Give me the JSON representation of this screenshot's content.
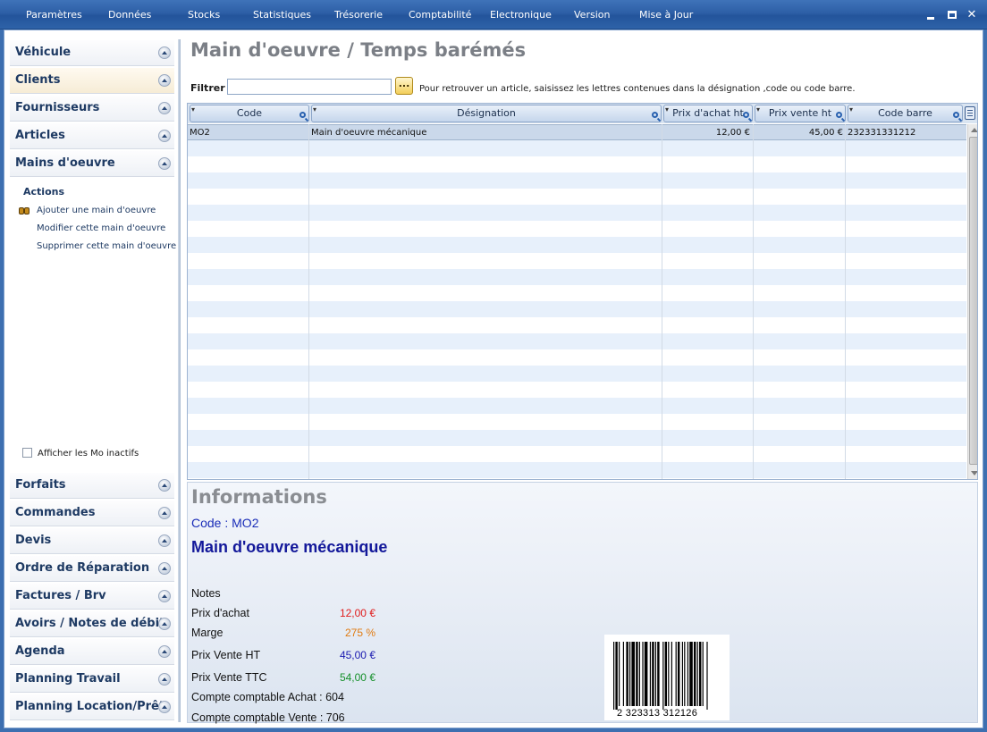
{
  "menu": {
    "items": [
      "Paramètres",
      "Données",
      "Stocks",
      "Statistiques",
      "Trésorerie",
      "Comptabilité",
      "Electronique",
      "Version",
      "Mise à Jour"
    ]
  },
  "window": {
    "close_glyph": "✕"
  },
  "sidebar": {
    "sections_top": [
      {
        "label": "Véhicule"
      },
      {
        "label": "Clients"
      },
      {
        "label": "Fournisseurs"
      },
      {
        "label": "Articles"
      },
      {
        "label": "Mains d'oeuvre"
      }
    ],
    "actions_title": "Actions",
    "actions": [
      "Ajouter une main d'oeuvre",
      "Modifier cette main d'oeuvre",
      "Supprimer cette main d'oeuvre"
    ],
    "inactive_checkbox_label": "Afficher les Mo inactifs",
    "sections_bottom": [
      {
        "label": "Forfaits"
      },
      {
        "label": "Commandes"
      },
      {
        "label": "Devis"
      },
      {
        "label": "Ordre de Réparation"
      },
      {
        "label": "Factures / Brv"
      },
      {
        "label": "Avoirs / Notes de débit"
      },
      {
        "label": "Agenda"
      },
      {
        "label": "Planning Travail"
      },
      {
        "label": "Planning Location/Prêt"
      }
    ]
  },
  "main": {
    "title": "Main d'oeuvre / Temps barémés",
    "filter_label": "Filtrer",
    "filter_value": "",
    "filter_button_label": "...",
    "filter_help": "Pour retrouver un article, saisissez les lettres contenues dans la désignation ,code ou code barre."
  },
  "grid": {
    "columns": [
      "Code",
      "Désignation",
      "Prix d'achat ht",
      "Prix vente ht",
      "Code barre"
    ],
    "rows": [
      {
        "code": "MO2",
        "designation": "Main d'oeuvre mécanique",
        "prix_achat": "12,00 €",
        "prix_vente": "45,00 €",
        "code_barre": "232331331212"
      }
    ]
  },
  "info": {
    "title": "Informations",
    "code_line": "Code : MO2",
    "designation": "Main d'oeuvre mécanique",
    "notes_label": "Notes",
    "prix_achat_label": "Prix d'achat",
    "prix_achat_value": "12,00 €",
    "marge_label": "Marge",
    "marge_value": "275 %",
    "prix_vente_ht_label": "Prix Vente HT",
    "prix_vente_ht_value": "45,00 €",
    "prix_vente_ttc_label": "Prix Vente TTC",
    "prix_vente_ttc_value": "54,00 €",
    "compte_achat_label": "Compte comptable Achat : 604",
    "compte_vente_label": "Compte comptable Vente : 706",
    "barcode_text": "2 323313 312126"
  },
  "colors": {
    "prix_achat": "#e01b1b",
    "marge": "#e07a10",
    "prix_vente_ht": "#1a1ab0",
    "prix_vente_ttc": "#15902a"
  }
}
